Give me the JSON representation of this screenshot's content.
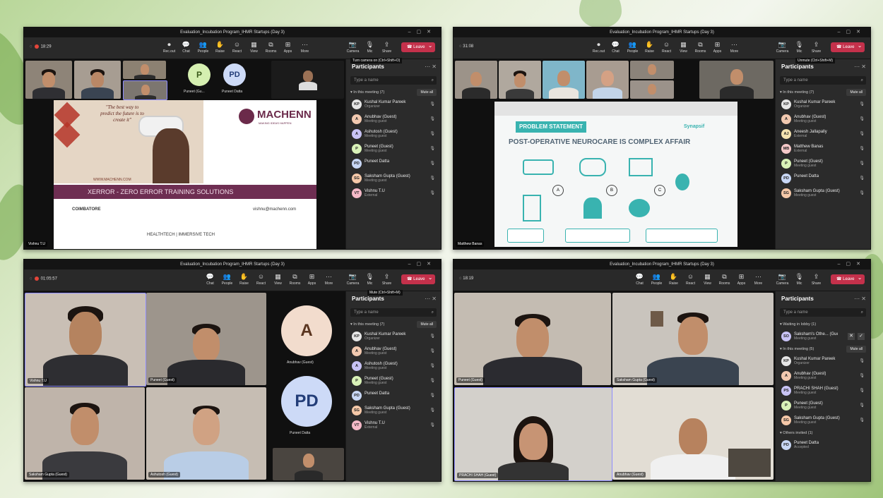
{
  "meeting": {
    "title": "Evaluation_Incubation Program_IHMR Startups (Day 3)",
    "leave_label": "Leave"
  },
  "toolbar": {
    "chat": "Chat",
    "people": "People",
    "raise": "Raise",
    "react": "React",
    "view": "View",
    "rooms": "Rooms",
    "apps": "Apps",
    "more": "More",
    "camera": "Camera",
    "mic": "Mic",
    "share": "Share",
    "record": "Rec.out"
  },
  "windows": [
    {
      "timer": "18:29",
      "tooltip": "Turn camera on (Ctrl+Shift+O)",
      "panel_title": "Participants",
      "search_placeholder": "Type a name",
      "section": "In this meeting (7)",
      "mute_all": "Mute all",
      "participants": [
        {
          "initials": "KP",
          "name": "Kushal Kumar Pareek",
          "role": "Organizer",
          "color": "#e6e6e6"
        },
        {
          "initials": "A",
          "name": "Anubhav (Guest)",
          "role": "Meeting guest",
          "color": "#f2c9b0"
        },
        {
          "initials": "A",
          "name": "Ashutosh (Guest)",
          "role": "Meeting guest",
          "color": "#c8c3f5"
        },
        {
          "initials": "P",
          "name": "Puneet (Guest)",
          "role": "Meeting guest",
          "color": "#d9f2b8"
        },
        {
          "initials": "PD",
          "name": "Puneet Datta",
          "role": "",
          "color": "#c8d7f5"
        },
        {
          "initials": "SG",
          "name": "Saksham Gupta (Guest)",
          "role": "Meeting guest",
          "color": "#f5c8a8"
        },
        {
          "initials": "VT",
          "name": "Vishnu T.U",
          "role": "External",
          "color": "#f5b9c8"
        }
      ],
      "avatar_p": "P",
      "avatar_p_name": "Puneet (Gu...",
      "avatar_pd": "PD",
      "avatar_pd_name": "Puneet Datta",
      "self_name": "Vishnu T.U",
      "slide": {
        "quote": "\"The best way to predict the future is to create it\"",
        "brand": "MACHENN",
        "brand_sub": "MAKING IDEAS HAPPEN",
        "website": "WWW.MACHENN.COM",
        "banner": "XERROR - ZERO ERROR TRAINING SOLUTIONS",
        "city": "COIMBATORE",
        "email": "vishnu@machenn.com",
        "tagline": "HEALTHTECH | IMMERSIVE TECH"
      }
    },
    {
      "timer": "31:08",
      "tooltip": "Unmute (Ctrl+Shift+M)",
      "panel_title": "Participants",
      "search_placeholder": "Type a name",
      "section": "In this meeting (7)",
      "mute_all": "Mute all",
      "participants": [
        {
          "initials": "KP",
          "name": "Kushal Kumar Pareek",
          "role": "Organizer",
          "color": "#e6e6e6"
        },
        {
          "initials": "A",
          "name": "Anubhav (Guest)",
          "role": "Meeting guest",
          "color": "#f2c9b0"
        },
        {
          "initials": "AJ",
          "name": "Aneesh Jallapally",
          "role": "External",
          "color": "#f5e3b0"
        },
        {
          "initials": "MB",
          "name": "Matthew Banas",
          "role": "External",
          "color": "#f5c8c8"
        },
        {
          "initials": "P",
          "name": "Puneet (Guest)",
          "role": "Meeting guest",
          "color": "#d9f2b8"
        },
        {
          "initials": "PD",
          "name": "Puneet Datta",
          "role": "",
          "color": "#c8d7f5"
        },
        {
          "initials": "SG",
          "name": "Saksham Gupta (Guest)",
          "role": "Meeting guest",
          "color": "#f5c8a8"
        }
      ],
      "self_name": "Matthew Banas",
      "slide": {
        "heading": "PROBLEM STATEMENT",
        "brand": "Synapsif",
        "title": "POST-OPERATIVE NEUROCARE IS COMPLEX AFFAIR",
        "steps": [
          "A",
          "B",
          "C"
        ]
      }
    },
    {
      "timer": "01:05:57",
      "tooltip": "Mute (Ctrl+Shift+M)",
      "panel_title": "Participants",
      "search_placeholder": "Type a name",
      "section": "In this meeting (7)",
      "mute_all": "Mute all",
      "participants": [
        {
          "initials": "KP",
          "name": "Kushal Kumar Pareek",
          "role": "Organizer",
          "color": "#e6e6e6"
        },
        {
          "initials": "A",
          "name": "Anubhav (Guest)",
          "role": "Meeting guest",
          "color": "#f2c9b0"
        },
        {
          "initials": "A",
          "name": "Ashutosh (Guest)",
          "role": "Meeting guest",
          "color": "#c8c3f5"
        },
        {
          "initials": "P",
          "name": "Puneet (Guest)",
          "role": "Meeting guest",
          "color": "#d9f2b8"
        },
        {
          "initials": "PD",
          "name": "Puneet Datta",
          "role": "",
          "color": "#c8d7f5"
        },
        {
          "initials": "SG",
          "name": "Saksham Gupta (Guest)",
          "role": "Meeting guest",
          "color": "#f5c8a8"
        },
        {
          "initials": "VT",
          "name": "Vishnu T.U",
          "role": "External",
          "color": "#f5b9c8"
        }
      ],
      "tiles": [
        "Vishnu T.U",
        "Puneet (Guest)",
        "Saksham Gupta (Guest)",
        "Ashutosh (Guest)"
      ],
      "avatar_a": "A",
      "avatar_a_name": "Anubhav (Guest)",
      "avatar_pd": "PD",
      "avatar_pd_name": "Puneet Datta"
    },
    {
      "timer": "18:19",
      "panel_title": "Participants",
      "search_placeholder": "Type a name",
      "lobby_section": "Waiting in lobby (1)",
      "lobby": {
        "initials": "SO",
        "name": "Saksham's Othe... (Guest)",
        "role": "Meeting guest",
        "color": "#c8c3f5"
      },
      "section": "In this meeting (5)",
      "mute_all": "Mute all",
      "participants": [
        {
          "initials": "KP",
          "name": "Kushal Kumar Pareek",
          "role": "Organizer",
          "color": "#e6e6e6"
        },
        {
          "initials": "A",
          "name": "Anubhav (Guest)",
          "role": "Meeting guest",
          "color": "#f2c9b0"
        },
        {
          "initials": "PS",
          "name": "PRACHI SHAH (Guest)",
          "role": "Meeting guest",
          "color": "#c8c3f5"
        },
        {
          "initials": "P",
          "name": "Puneet (Guest)",
          "role": "Meeting guest",
          "color": "#d9f2b8"
        },
        {
          "initials": "SG",
          "name": "Saksham Gupta (Guest)",
          "role": "Meeting guest",
          "color": "#f5c8a8"
        }
      ],
      "invited_section": "Others invited (1)",
      "invited": {
        "initials": "PD",
        "name": "Puneet Datta",
        "role": "Accepted",
        "color": "#c8d7f5"
      },
      "tiles": [
        "Puneet (Guest)",
        "Saksham Gupta (Guest)",
        "PRACHI SHAH (Guest)",
        "Anubhav (Guest)"
      ]
    }
  ]
}
